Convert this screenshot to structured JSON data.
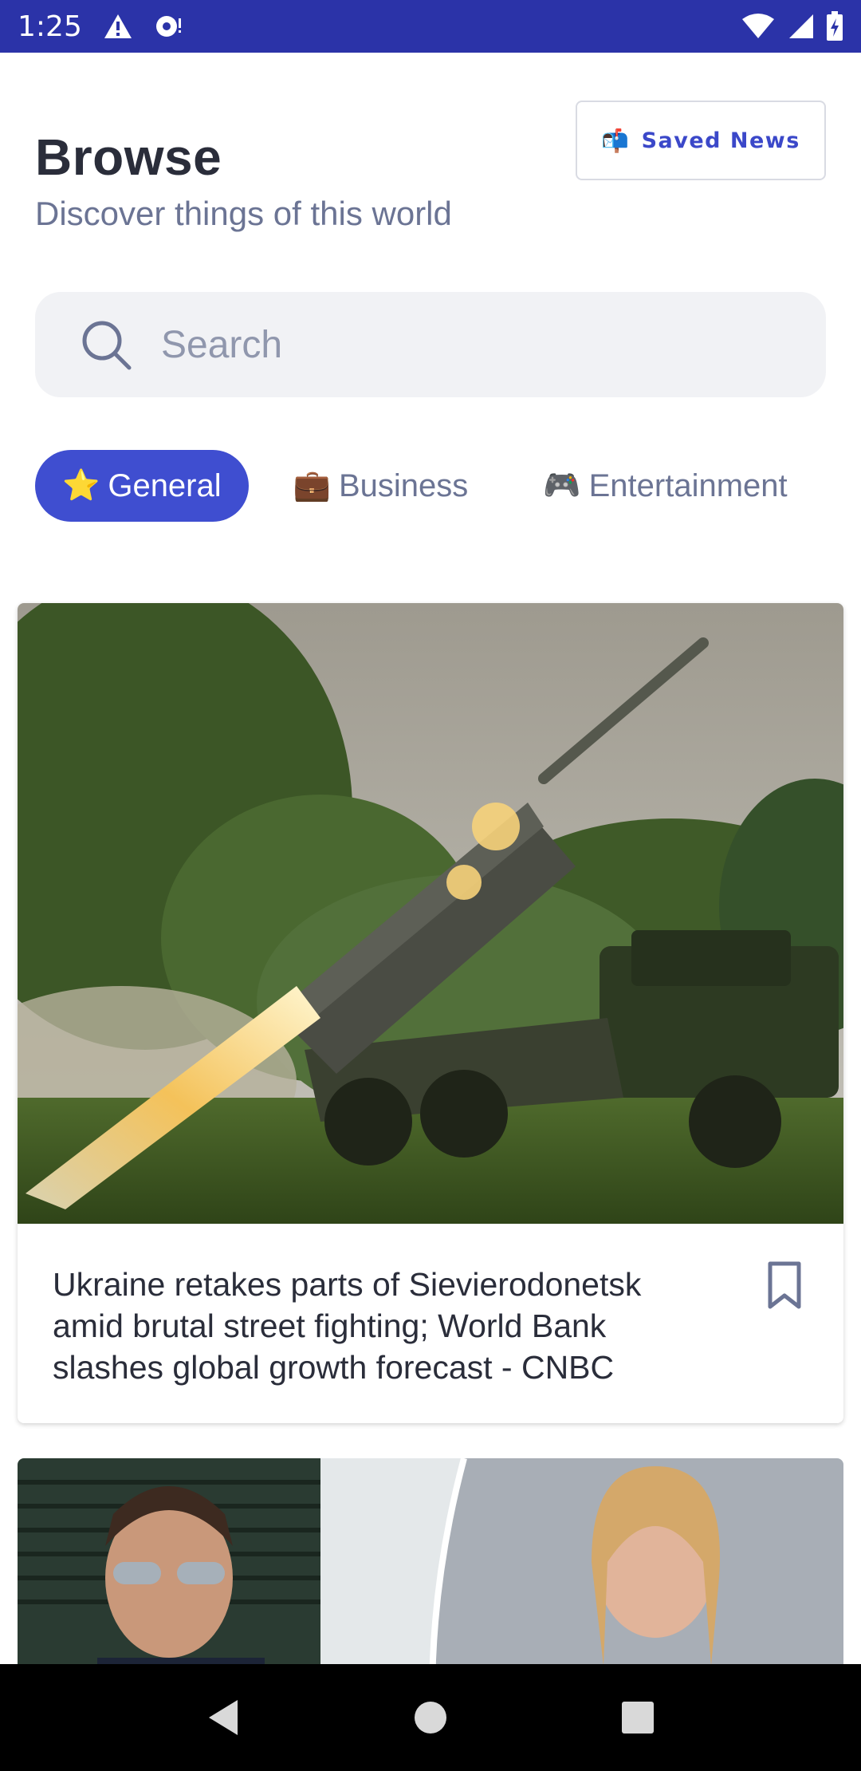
{
  "status_bar": {
    "time": "1:25"
  },
  "header": {
    "title": "Browse",
    "subtitle": "Discover things of this world",
    "saved_news_emoji": "📬",
    "saved_news_label": "Saved News"
  },
  "search": {
    "placeholder": "Search",
    "value": ""
  },
  "categories": [
    {
      "emoji": "⭐",
      "label": "General",
      "active": true
    },
    {
      "emoji": "💼",
      "label": "Business",
      "active": false
    },
    {
      "emoji": "🎮",
      "label": "Entertainment",
      "active": false
    }
  ],
  "articles": [
    {
      "title": "Ukraine retakes parts of Sievierodonetsk amid brutal street fighting; World Bank slashes global growth forecast - CNBC",
      "bookmarked": false,
      "image_subject": "rocket-launcher"
    },
    {
      "title": "",
      "image_subject": "portraits"
    }
  ],
  "colors": {
    "status_bar": "#2b33a8",
    "accent": "#3f4ed0",
    "text_primary": "#2a2d3a",
    "text_secondary": "#6b7494"
  },
  "icons": {
    "status": [
      "warning-icon",
      "notification-icon",
      "wifi-icon",
      "signal-icon",
      "battery-icon"
    ],
    "search": "search-icon",
    "bookmark": "bookmark-outline-icon",
    "nav": [
      "back-icon",
      "home-icon",
      "recents-icon"
    ]
  }
}
